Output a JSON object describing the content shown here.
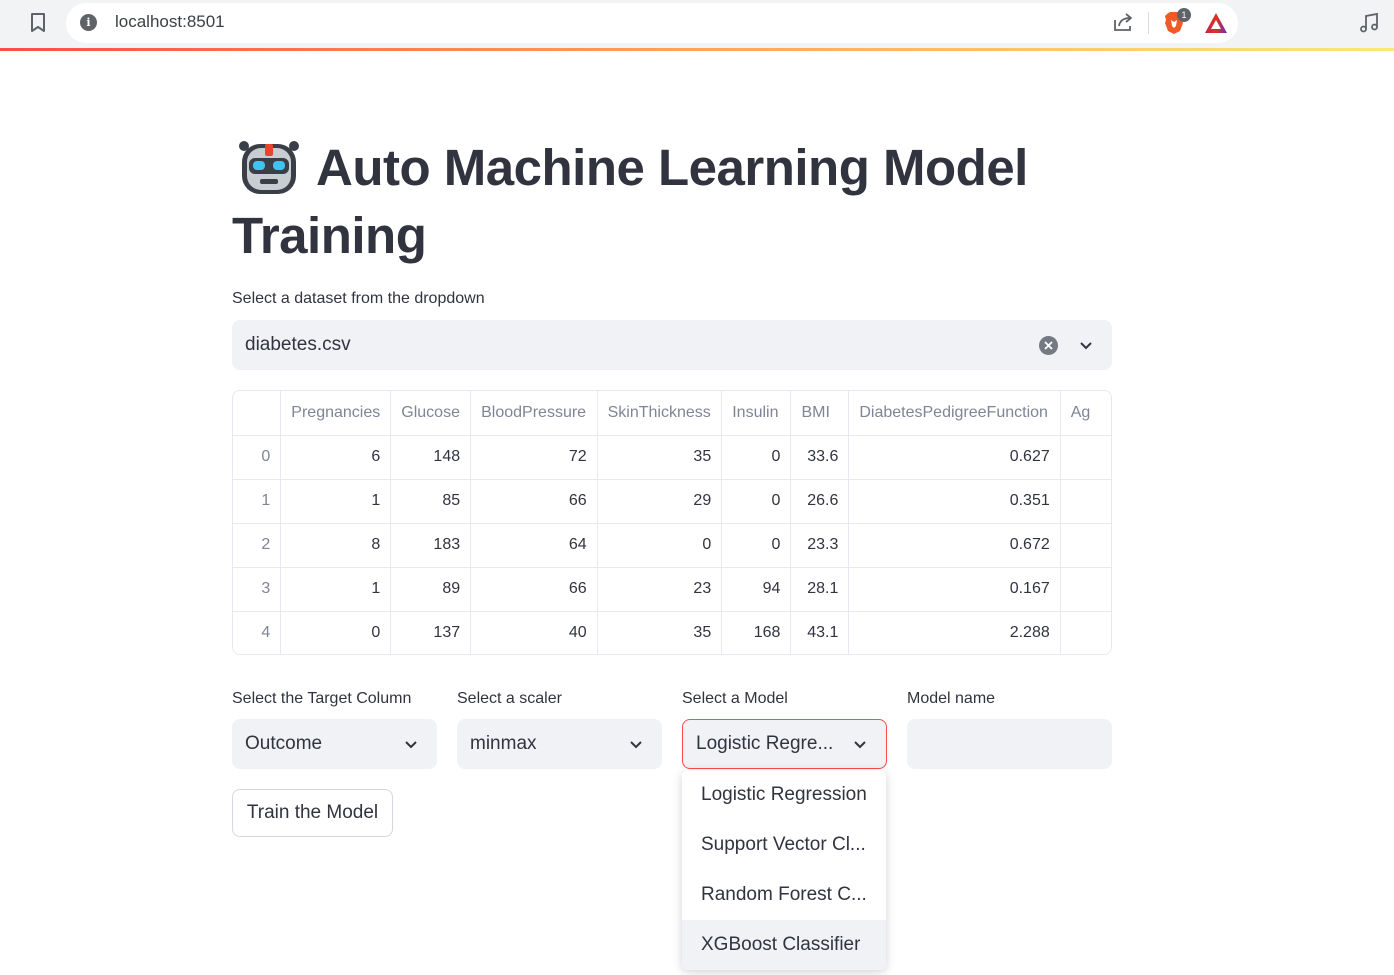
{
  "browser": {
    "url": "localhost:8501",
    "extension_badge": "1"
  },
  "page": {
    "title": "Auto Machine Learning Model Training",
    "title_line1": "Auto Machine Learning Model",
    "title_line2": "Training"
  },
  "dataset_select": {
    "label": "Select a dataset from the dropdown",
    "value": "diabetes.csv"
  },
  "table": {
    "columns": [
      "Pregnancies",
      "Glucose",
      "BloodPressure",
      "SkinThickness",
      "Insulin",
      "BMI",
      "DiabetesPedigreeFunction",
      "Ag"
    ],
    "rows": [
      {
        "index": "0",
        "cells": [
          "6",
          "148",
          "72",
          "35",
          "0",
          "33.6",
          "0.627",
          ""
        ]
      },
      {
        "index": "1",
        "cells": [
          "1",
          "85",
          "66",
          "29",
          "0",
          "26.6",
          "0.351",
          ""
        ]
      },
      {
        "index": "2",
        "cells": [
          "8",
          "183",
          "64",
          "0",
          "0",
          "23.3",
          "0.672",
          ""
        ]
      },
      {
        "index": "3",
        "cells": [
          "1",
          "89",
          "66",
          "23",
          "94",
          "28.1",
          "0.167",
          ""
        ]
      },
      {
        "index": "4",
        "cells": [
          "0",
          "137",
          "40",
          "35",
          "168",
          "43.1",
          "2.288",
          ""
        ]
      }
    ]
  },
  "target_select": {
    "label": "Select the Target Column",
    "value": "Outcome"
  },
  "scaler_select": {
    "label": "Select a scaler",
    "value": "minmax"
  },
  "model_select": {
    "label": "Select a Model",
    "value": "Logistic Regre...",
    "options": [
      "Logistic Regression",
      "Support Vector Cl...",
      "Random Forest C...",
      "XGBoost Classifier"
    ]
  },
  "model_name": {
    "label": "Model name",
    "value": ""
  },
  "train_button": {
    "label": "Train the Model"
  },
  "colors": {
    "accent": "#ff4b4b",
    "input_bg": "#f0f2f6",
    "text": "#31333f"
  }
}
